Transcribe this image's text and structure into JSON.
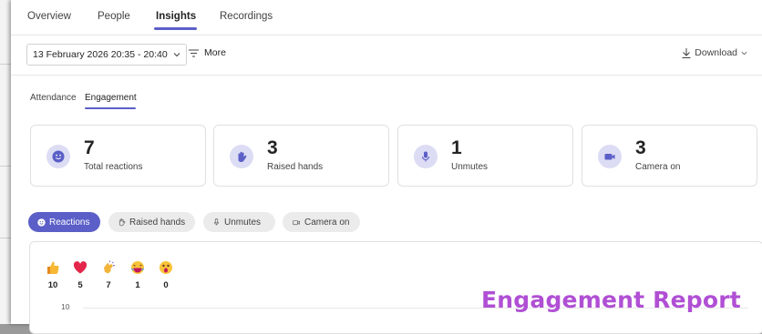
{
  "top_tabs": [
    {
      "label": "Overview",
      "active": false
    },
    {
      "label": "People",
      "active": false
    },
    {
      "label": "Insights",
      "active": true
    },
    {
      "label": "Recordings",
      "active": false
    }
  ],
  "toolbar": {
    "date_range": "13 February 2026 20:35 - 20:40",
    "more_label": "More",
    "download_label": "Download"
  },
  "sub_tabs": [
    {
      "label": "Attendance",
      "active": false
    },
    {
      "label": "Engagement",
      "active": true
    }
  ],
  "stats": [
    {
      "value": "7",
      "label": "Total reactions",
      "icon": "smiley-icon"
    },
    {
      "value": "3",
      "label": "Raised hands",
      "icon": "hand-icon"
    },
    {
      "value": "1",
      "label": "Unmutes",
      "icon": "microphone-icon"
    },
    {
      "value": "3",
      "label": "Camera on",
      "icon": "camera-icon"
    }
  ],
  "filters": [
    {
      "label": "Reactions",
      "active": true
    },
    {
      "label": "Raised hands",
      "active": false
    },
    {
      "label": "Unmutes",
      "active": false
    },
    {
      "label": "Camera on",
      "active": false
    }
  ],
  "reactions": [
    {
      "icon": "thumbs-up-icon",
      "count": "10"
    },
    {
      "icon": "heart-icon",
      "count": "5"
    },
    {
      "icon": "clap-icon",
      "count": "7"
    },
    {
      "icon": "laugh-icon",
      "count": "1"
    },
    {
      "icon": "surprised-icon",
      "count": "0"
    }
  ],
  "chart": {
    "y_tick_top": "10"
  },
  "watermark": "Engagement Report",
  "colors": {
    "accent": "#5b5fc7",
    "accent_light": "#dcdcf4",
    "watermark": "#b04fd4"
  }
}
